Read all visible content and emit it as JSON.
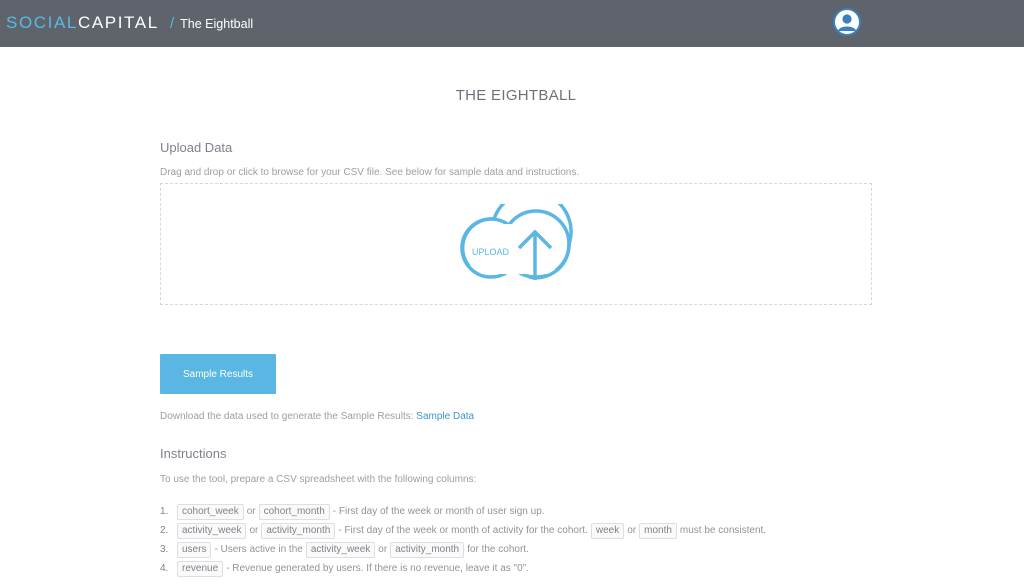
{
  "header": {
    "brand_part1": "SOCIAL",
    "brand_part2": "CAPITAL",
    "breadcrumb_separator": "/",
    "breadcrumb_label": "The Eightball",
    "avatar_icon": "user-avatar-icon"
  },
  "main": {
    "title": "THE EIGHTBALL",
    "upload": {
      "heading": "Upload Data",
      "description": "Drag and drop or click to browse for your CSV file. See below for sample data and instructions.",
      "icon_label": "UPLOAD",
      "icon": "cloud-upload-icon"
    },
    "sample_button_label": "Sample Results",
    "download_text": "Download the data used to generate the Sample Results:",
    "download_link": "Sample Data",
    "instructions": {
      "heading": "Instructions",
      "intro": "To use the tool, prepare a CSV spreadsheet with the following columns:",
      "items": [
        {
          "num": "1.",
          "c1": "cohort_week",
          "t1": "or",
          "c2": "cohort_month",
          "t2": "- First day of the week or month of user sign up."
        },
        {
          "num": "2.",
          "c1": "activity_week",
          "t1": "or",
          "c2": "activity_month",
          "t2": "- First day of the week or month of activity for the cohort.",
          "c3": "week",
          "t3": "or",
          "c4": "month",
          "t4": "must be consistent."
        },
        {
          "num": "3.",
          "c1": "users",
          "t1": "- Users active in the",
          "c2": "activity_week",
          "t2": "or",
          "c3": "activity_month",
          "t3": "for the cohort."
        },
        {
          "num": "4.",
          "c1": "revenue",
          "t1": "- Revenue generated by users. If there is no revenue, leave it as \"0\"."
        }
      ]
    }
  },
  "colors": {
    "topbar": "#5f646c",
    "accent": "#5ab6e3",
    "link": "#3d95cf"
  }
}
